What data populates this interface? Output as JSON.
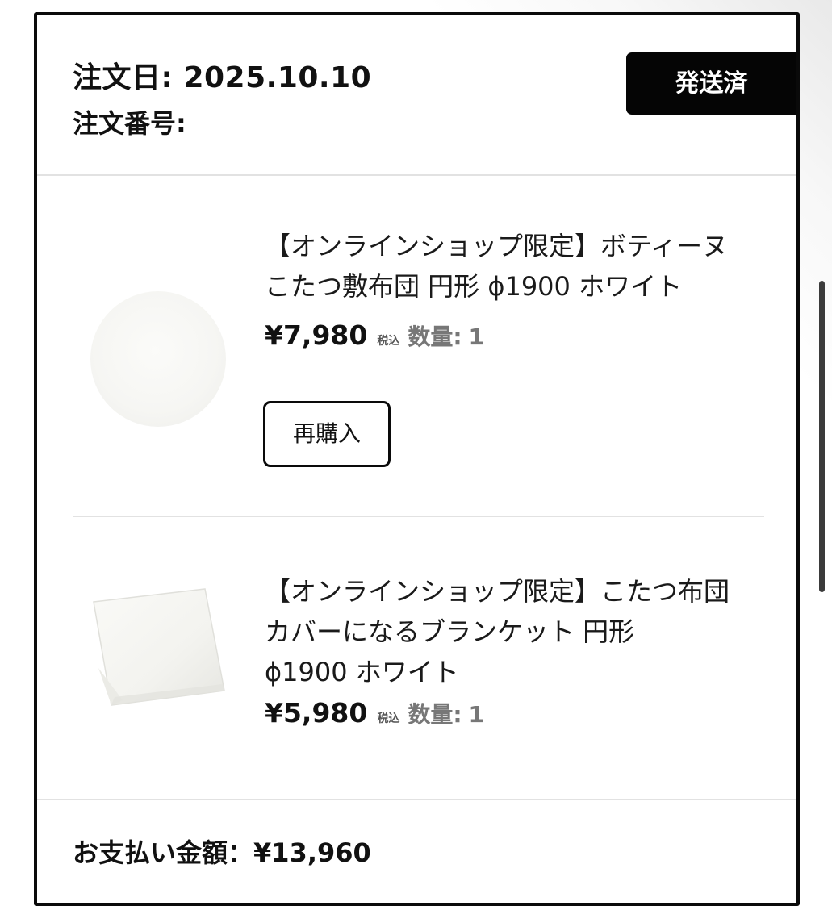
{
  "order": {
    "date_label": "注文日:",
    "date_value": "2025.10.10",
    "number_label": "注文番号:",
    "status": "発送済"
  },
  "items": [
    {
      "name_lines": [
        "【オンラインショップ限定】ボティーヌ",
        "こたつ敷布団 円形 ϕ1900 ホワイト"
      ],
      "price": "¥7,980",
      "tax_label": "税込",
      "qty_label": "数量:",
      "qty_value": "1",
      "rebuy_label": "再購入",
      "image": "round-white-rug-image"
    },
    {
      "name_lines": [
        "【オンラインショップ限定】こたつ布団",
        "カバーになるブランケット 円形",
        "ϕ1900 ホワイト"
      ],
      "price": "¥5,980",
      "tax_label": "税込",
      "qty_label": "数量:",
      "qty_value": "1",
      "image": "folded-white-blanket-image"
    }
  ],
  "total": {
    "label": "お支払い金額：",
    "value": "¥13,960"
  },
  "colors": {
    "badge_bg": "#050505",
    "card_border": "#0a0a0a",
    "divider": "#e2e2e2",
    "muted_text": "#777777"
  }
}
